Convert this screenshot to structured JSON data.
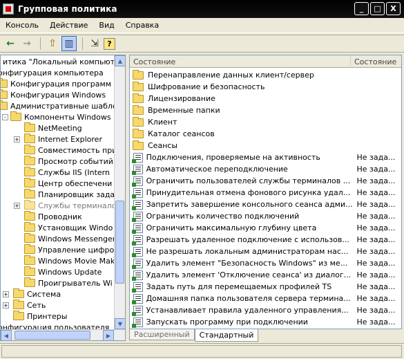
{
  "window": {
    "title": "Групповая политика",
    "minimize_label": "_",
    "maximize_label": "□",
    "close_label": "X"
  },
  "menu": {
    "items": [
      "Консоль",
      "Действие",
      "Вид",
      "Справка"
    ]
  },
  "toolbar": {
    "back_icon": "←",
    "forward_icon": "→",
    "up_icon": "⇧",
    "show_hide_tree_icon": "▥",
    "export_icon": "⇲",
    "help_icon": "?"
  },
  "tree": {
    "items": [
      {
        "label": "итика \"Локальный компьют",
        "expander": ""
      },
      {
        "label": "онфигурация компьютера",
        "expander": ""
      },
      {
        "label": "Конфигурация программ",
        "expander": ""
      },
      {
        "label": "Конфигурация Windows",
        "expander": ""
      },
      {
        "label": "Административные шабло",
        "expander": ""
      },
      {
        "label": "Компоненты Windows",
        "expander": "-"
      },
      {
        "label": "NetMeeting",
        "expander": ""
      },
      {
        "label": "Internet Explorer",
        "expander": "+"
      },
      {
        "label": "Совместимость при",
        "expander": ""
      },
      {
        "label": "Просмотр событий",
        "expander": ""
      },
      {
        "label": "Службы IIS (Intern",
        "expander": ""
      },
      {
        "label": "Центр обеспечени",
        "expander": ""
      },
      {
        "label": "Планировщик зада",
        "expander": ""
      },
      {
        "label": "Службы терминало",
        "expander": "+"
      },
      {
        "label": "Проводник",
        "expander": ""
      },
      {
        "label": "Установщик Windo",
        "expander": ""
      },
      {
        "label": "Windows Messenger",
        "expander": ""
      },
      {
        "label": "Управление цифро",
        "expander": ""
      },
      {
        "label": "Windows Movie Mak",
        "expander": ""
      },
      {
        "label": "Windows Update",
        "expander": ""
      },
      {
        "label": "Проигрыватель Wi",
        "expander": ""
      },
      {
        "label": "Система",
        "expander": "+"
      },
      {
        "label": "Сеть",
        "expander": "+"
      },
      {
        "label": "Принтеры",
        "expander": ""
      },
      {
        "label": "онфигурация пользователя",
        "expander": ""
      }
    ]
  },
  "list": {
    "header_name": "Состояние",
    "header_state": "Состояние",
    "folders": [
      "Перенаправление данных клиент/сервер",
      "Шифрование и безопасность",
      "Лицензирование",
      "Временные папки",
      "Клиент",
      "Каталог сеансов",
      "Сеансы"
    ],
    "settings": [
      {
        "name": "Подключения, проверяемые на активность",
        "state": "Не зада..."
      },
      {
        "name": "Автоматическое переподключение",
        "state": "Не зада..."
      },
      {
        "name": "Ограничить пользователей службы терминалов ...",
        "state": "Не зада..."
      },
      {
        "name": "Принудительная отмена фонового рисунка удал...",
        "state": "Не зада..."
      },
      {
        "name": "Запретить завершение консольного сеанса адми...",
        "state": "Не зада..."
      },
      {
        "name": "Ограничить количество подключений",
        "state": "Не зада..."
      },
      {
        "name": "Ограничить максимальную глубину цвета",
        "state": "Не зада..."
      },
      {
        "name": "Разрешать удаленное подключение с использов...",
        "state": "Не зада..."
      },
      {
        "name": "Не разрешать локальным администраторам нас...",
        "state": "Не зада..."
      },
      {
        "name": "Удалить элемент \"Безопасность Windows\" из ме...",
        "state": "Не зада..."
      },
      {
        "name": "Удалить элемент 'Отключение сеанса' из диалог...",
        "state": "Не зада..."
      },
      {
        "name": "Задать путь для перемещаемых профилей TS",
        "state": "Не зада..."
      },
      {
        "name": "Домашняя папка пользователя сервера термина...",
        "state": "Не зада..."
      },
      {
        "name": "Устанавливает правила удаленного управления...",
        "state": "Не зада..."
      },
      {
        "name": "Запускать программу при подключении",
        "state": "Не зада..."
      }
    ]
  },
  "tabs": {
    "extended": "Расширенный",
    "standard": "Стандартный"
  }
}
